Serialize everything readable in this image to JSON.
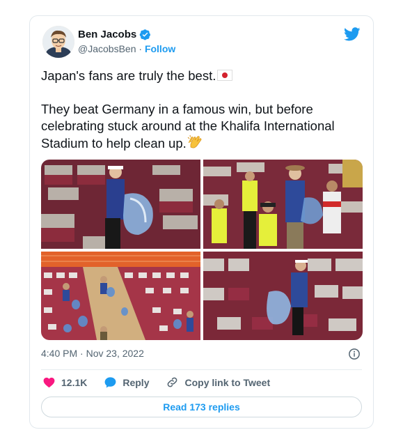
{
  "author": {
    "name": "Ben Jacobs",
    "handle": "@JacobsBen",
    "separator": " · ",
    "follow_label": "Follow"
  },
  "tweet": {
    "line1": "Japan's fans are truly the best.",
    "line2": "They beat Germany in a famous win, but before celebrating stuck around at the Khalifa International Stadium to help clean up.",
    "timestamp": "4:40 PM · Nov 23, 2022"
  },
  "actions": {
    "likes": "12.1K",
    "reply_label": "Reply",
    "copy_label": "Copy link to Tweet"
  },
  "replies_button": "Read 173 replies",
  "colors": {
    "twitter_blue": "#1d9bf0",
    "like_pink": "#f91880",
    "muted": "#536471"
  }
}
